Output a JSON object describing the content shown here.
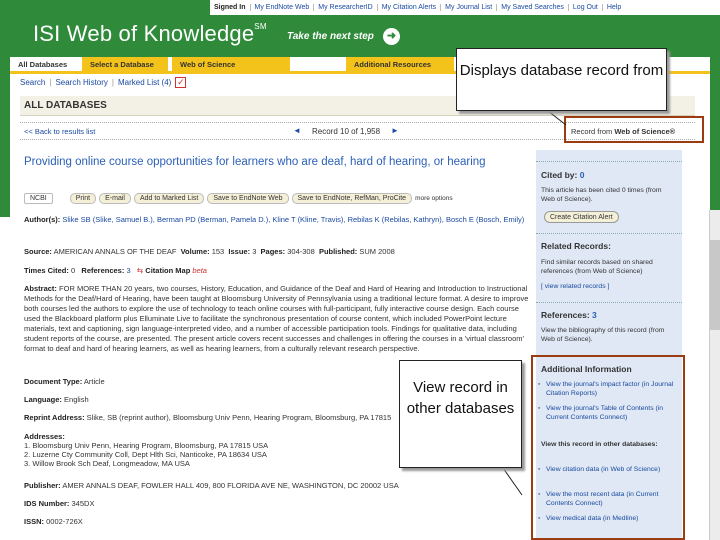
{
  "top_links": [
    "Signed In",
    "My EndNote Web",
    "My ResearcherID",
    "My Citation Alerts",
    "My Journal List",
    "My Saved Searches",
    "Log Out",
    "Help"
  ],
  "header": {
    "logo": "ISI Web of Knowledge",
    "logo_mark": "SM",
    "tagline": "Take the next step"
  },
  "tabs": [
    "All Databases",
    "Select a Database",
    "Web of Science",
    "Additional Resources"
  ],
  "subnav": {
    "search": "Search",
    "history": "Search History",
    "marked": "Marked List (4)"
  },
  "page_title": "ALL DATABASES",
  "record_nav": {
    "back": "<< Back to results list",
    "prev": "◄",
    "position": "Record 10 of 1,958",
    "next": "►",
    "record_from_prefix": "Record from",
    "record_from_db": "Web of Science®"
  },
  "record": {
    "title": "Providing online course opportunities for learners who are deaf, hard of hearing, or hearing",
    "buttons": [
      "NCBI",
      "Print",
      "E-mail",
      "Add to Marked List",
      "Save to EndNote Web",
      "Save to EndNote, RefMan, ProCite",
      "more options"
    ],
    "authors_label": "Author(s):",
    "authors": "Slike SB (Slike, Samuel B.), Berman PD (Berman, Pamela D.), Kline T (Kline, Travis), Rebilas K (Rebilas, Kathryn), Bosch E (Bosch, Emily)",
    "source_label": "Source:",
    "source": "AMERICAN ANNALS OF THE DEAF",
    "volume_label": "Volume:",
    "volume": "153",
    "issue_label": "Issue:",
    "issue": "3",
    "pages_label": "Pages:",
    "pages": "304-308",
    "published_label": "Published:",
    "published": "SUM 2008",
    "times_cited_label": "Times Cited:",
    "times_cited": "0",
    "references_label": "References:",
    "references": "3",
    "citation_map": "Citation Map",
    "citation_map_badge": "beta",
    "abstract_label": "Abstract:",
    "abstract": "FOR MORE THAN 20 years, two courses, History, Education, and Guidance of the Deaf and Hard of Hearing and Introduction to Instructional Methods for the Deaf/Hard of Hearing, have been taught at Bloomsburg University of Pennsylvania using a traditional lecture format. A desire to improve both courses led the authors to explore the use of technology to teach online courses with full-participant, fully interactive course design. Each course used the Blackboard platform plus Elluminate Live to facilitate the synchronous presentation of course content, which included PowerPoint lecture materials, text and captioning, sign language-interpreted video, and a number of accessible participation tools. Findings for qualitative data, including student reports of the course, are presented. The present article covers recent successes and challenges in offering the courses in a 'virtual classroom' format to deaf and hard of hearing learners, as well as hearing learners, from a culturally relevant research perspective.",
    "doctype_label": "Document Type:",
    "doctype": "Article",
    "language_label": "Language:",
    "language": "English",
    "reprint_label": "Reprint Address:",
    "reprint": "Slike, SB (reprint author), Bloomsburg Univ Penn, Hearing Program, Bloomsburg, PA 17815 USA",
    "addresses_label": "Addresses:",
    "addresses": [
      "1. Bloomsburg Univ Penn, Hearing Program, Bloomsburg, PA 17815 USA",
      "2. Luzerne Cty Community Coll, Dept Hlth Sci, Nanticoke, PA 18634 USA",
      "3. Willow Brook Sch Deaf, Longmeadow, MA USA"
    ],
    "publisher_label": "Publisher:",
    "publisher": "AMER ANNALS DEAF, FOWLER HALL 409, 800 FLORIDA AVE NE, WASHINGTON, DC 20002 USA",
    "ids_label": "IDS Number:",
    "ids": "345DX",
    "issn_label": "ISSN:",
    "issn": "0002-726X"
  },
  "right_panel": {
    "cited_by_label": "Cited by:",
    "cited_by": "0",
    "cited_by_text": "This article has been cited 0 times (from Web of Science).",
    "citation_alert_button": "Create Citation Alert",
    "related_title": "Related Records:",
    "related_text": "Find similar records based on shared references (from Web of Science)",
    "related_link": "[ view related records ]",
    "references_label": "References:",
    "references": "3",
    "references_text": "View the bibliography of this record (from Web of Science).",
    "additional_title": "Additional Information",
    "additional_links": [
      "View the journal's impact factor (in Journal Citation Reports)",
      "View the journal's Table of Contents (in Current Contents Connect)"
    ],
    "other_db_title": "View this record in other databases:",
    "other_db_links": [
      "View citation data (in Web of Science)",
      "View the most recent data (in Current Contents Connect)",
      "View medical data (in Medline)"
    ]
  },
  "annotations": {
    "callout_top": "Displays database record from",
    "callout_bottom": "View record in other databases"
  },
  "colors": {
    "banner_green": "#2f8a3a",
    "tab_yellow": "#f3c21b",
    "link_blue": "#1a4aa0",
    "title_blue": "#2c60b6",
    "panel_blue": "#dfe8f4",
    "highlight_brown": "#9a3b12"
  }
}
